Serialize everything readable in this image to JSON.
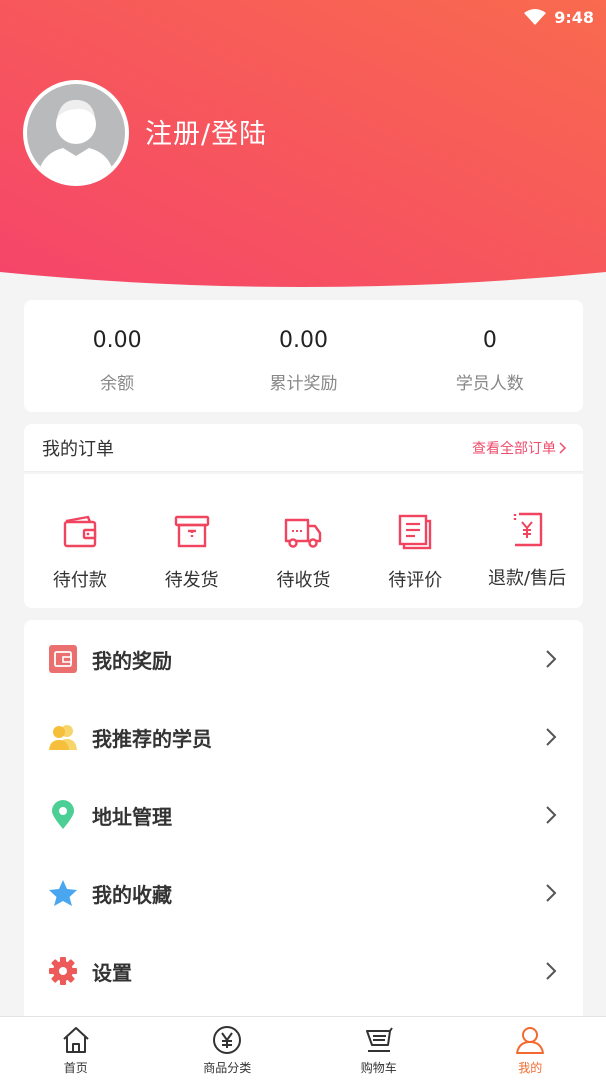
{
  "status": {
    "time": "9:48"
  },
  "profile": {
    "login_label": "注册/登陆"
  },
  "stats": [
    {
      "value": "0.00",
      "label": "余额"
    },
    {
      "value": "0.00",
      "label": "累计奖励"
    },
    {
      "value": "0",
      "label": "学员人数"
    }
  ],
  "orders": {
    "title": "我的订单",
    "view_all": "查看全部订单",
    "items": [
      {
        "label": "待付款",
        "icon": "wallet-icon"
      },
      {
        "label": "待发货",
        "icon": "package-icon"
      },
      {
        "label": "待收货",
        "icon": "truck-icon"
      },
      {
        "label": "待评价",
        "icon": "review-icon"
      },
      {
        "label": "退款/售后",
        "icon": "refund-icon"
      }
    ]
  },
  "menu": [
    {
      "label": "我的奖励",
      "icon": "reward-wallet-icon"
    },
    {
      "label": "我推荐的学员",
      "icon": "users-icon"
    },
    {
      "label": "地址管理",
      "icon": "location-pin-icon"
    },
    {
      "label": "我的收藏",
      "icon": "star-icon"
    },
    {
      "label": "设置",
      "icon": "gear-icon"
    }
  ],
  "tabs": [
    {
      "label": "首页",
      "icon": "home-icon",
      "active": false
    },
    {
      "label": "商品分类",
      "icon": "yen-circle-icon",
      "active": false
    },
    {
      "label": "购物车",
      "icon": "cart-icon",
      "active": false
    },
    {
      "label": "我的",
      "icon": "user-icon",
      "active": true
    }
  ],
  "colors": {
    "accent": "#f0445f",
    "gradient_start": "#f5456a",
    "gradient_end": "#f96a4e",
    "active_tab": "#f26a2f"
  }
}
